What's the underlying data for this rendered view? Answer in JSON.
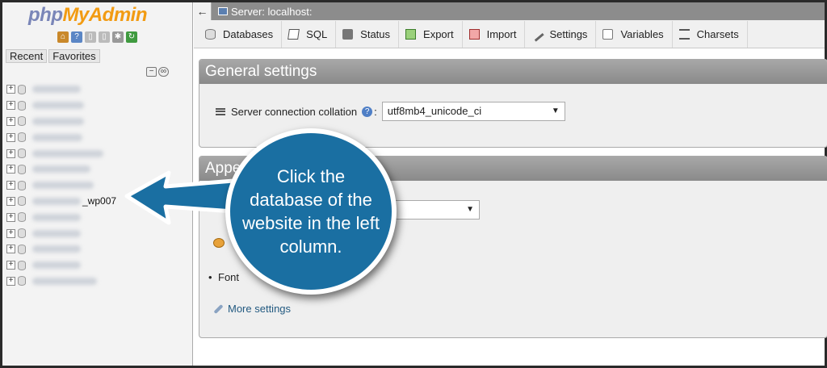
{
  "sidebar": {
    "logo_php": "php",
    "logo_ma": "MyAdmin",
    "recent_label": "Recent",
    "favorites_label": "Favorites",
    "icons": [
      "home-icon",
      "logout-icon",
      "docs-icon",
      "sql-docs-icon",
      "settings-icon",
      "reload-icon"
    ],
    "databases": [
      {
        "name": ""
      },
      {
        "name": ""
      },
      {
        "name": ""
      },
      {
        "name": ""
      },
      {
        "name": ""
      },
      {
        "name": ""
      },
      {
        "name": ""
      },
      {
        "name": "_wp007"
      },
      {
        "name": ""
      },
      {
        "name": ""
      },
      {
        "name": ""
      },
      {
        "name": ""
      },
      {
        "name": ""
      }
    ]
  },
  "topbar": {
    "server_label": "Server: localhost:"
  },
  "tabs": [
    {
      "label": "Databases",
      "icon": "database-icon"
    },
    {
      "label": "SQL",
      "icon": "sql-icon"
    },
    {
      "label": "Status",
      "icon": "status-icon"
    },
    {
      "label": "Export",
      "icon": "export-icon"
    },
    {
      "label": "Import",
      "icon": "import-icon"
    },
    {
      "label": "Settings",
      "icon": "wrench-icon"
    },
    {
      "label": "Variables",
      "icon": "variables-icon"
    },
    {
      "label": "Charsets",
      "icon": "charsets-icon"
    }
  ],
  "general_settings": {
    "title": "General settings",
    "collation_label": "Server connection collation",
    "collation_colon": ":",
    "collation_value": "utf8mb4_unicode_ci"
  },
  "appearance": {
    "title_visible": "Appe",
    "font_item": "Font",
    "more_settings": "More settings"
  },
  "callout": {
    "text": "Click the database of the website in the left column.",
    "color": "#1a6fa2"
  }
}
